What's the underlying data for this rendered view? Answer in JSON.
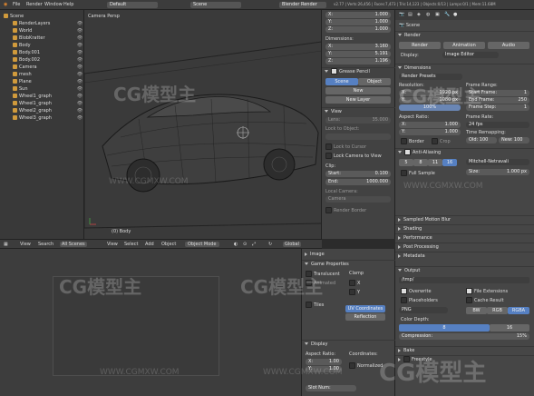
{
  "topbar": {
    "menu": [
      "File",
      "Render",
      "Window",
      "Help"
    ],
    "layout": "Default",
    "scene": "Scene",
    "engine": "Blender Render",
    "stats": "v2.77 | Verts:26,456 | Faces:7,473 | Tris:14,123 | Objects:0/13 | Lamps:0/1 | Mem:11.68M"
  },
  "outliner": {
    "items": [
      {
        "label": "Scene",
        "depth": 0
      },
      {
        "label": "RenderLayers",
        "depth": 1
      },
      {
        "label": "World",
        "depth": 1
      },
      {
        "label": "BlobKratter",
        "depth": 1
      },
      {
        "label": "Body",
        "depth": 1
      },
      {
        "label": "Body.001",
        "depth": 1
      },
      {
        "label": "Body.002",
        "depth": 1
      },
      {
        "label": "Camera",
        "depth": 1
      },
      {
        "label": "mesh",
        "depth": 1
      },
      {
        "label": "Plane",
        "depth": 1
      },
      {
        "label": "Sun",
        "depth": 1
      },
      {
        "label": "Wheel1_graph",
        "depth": 1
      },
      {
        "label": "Wheel1_graph",
        "depth": 1
      },
      {
        "label": "Wheel2_graph",
        "depth": 1
      },
      {
        "label": "Wheel3_graph",
        "depth": 1
      }
    ]
  },
  "viewport": {
    "title": "Camera Persp",
    "object_label": "(0) Body"
  },
  "npanel": {
    "scale": [
      {
        "axis": "X:",
        "value": "1.000"
      },
      {
        "axis": "Y:",
        "value": "1.000"
      },
      {
        "axis": "Z:",
        "value": "1.000"
      }
    ],
    "dimensions_title": "Dimensions:",
    "dimensions": [
      {
        "axis": "X:",
        "value": "3.160"
      },
      {
        "axis": "Y:",
        "value": "5.191"
      },
      {
        "axis": "Z:",
        "value": "1.196"
      }
    ],
    "grease_pencil": "Grease Pencil",
    "gp_tabs": [
      "Scene",
      "Object"
    ],
    "gp_new": "New",
    "gp_new_layer": "New Layer",
    "view_title": "View",
    "lens": "Lens:",
    "lens_value": "35.000",
    "lock_to_object": "Lock to Object:",
    "lock_to_cursor": "Lock to Cursor",
    "lock_camera": "Lock Camera to View",
    "clip_title": "Clip:",
    "clip_start": "Start:",
    "clip_start_value": "0.100",
    "clip_end": "End:",
    "clip_end_value": "1000.000",
    "local_camera": "Local Camera:",
    "camera_value": "Camera",
    "render_border": "Render Border"
  },
  "view_header": {
    "menu": [
      "View",
      "Search",
      "All Scenes",
      "View",
      "Select",
      "Add",
      "Object"
    ],
    "mode": "Object Mode",
    "orientation": "Global"
  },
  "uv_panel": {
    "image_title": "Image",
    "game_props": "Game Properties",
    "translucent": "Translucent",
    "clamp_title": "Clamp",
    "clamp_x": "X",
    "clamp_y": "Y",
    "animated": "Animated",
    "tiles": "Tiles",
    "uv_coordinates": "UV Coordinates",
    "reflection": "Reflection",
    "display_title": "Display",
    "aspect_ratio": "Aspect Ratio:",
    "coordinates": "Coordinates:",
    "ax": "X:",
    "ax_value": "1.00",
    "ay": "Y:",
    "ay_value": "1.00",
    "normalized": "Normalized",
    "slot_num": "Slot Num:"
  },
  "props": {
    "scene": "Scene",
    "render_title": "Render",
    "render_btns": [
      "Render",
      "Animation",
      "Audio"
    ],
    "display_label": "Display:",
    "display_value": "Image Editor",
    "dimensions_title": "Dimensions",
    "render_presets": "Render Presets",
    "resolution_label": "Resolution:",
    "res_x": "X:",
    "res_x_value": "1920 px",
    "res_y": "Y:",
    "res_y_value": "1080 px",
    "res_pct": "100%",
    "frame_range": "Frame Range:",
    "start_frame": "Start Frame:",
    "start_frame_value": "1",
    "end_frame": "End Frame:",
    "end_frame_value": "250",
    "frame_step": "Frame Step:",
    "frame_step_value": "1",
    "aspect_label": "Aspect Ratio:",
    "asp_x": "X:",
    "asp_x_value": "1.000",
    "asp_y": "Y:",
    "asp_y_value": "1.000",
    "frame_rate": "Frame Rate:",
    "fps": "24 fps",
    "time_remap": "Time Remapping:",
    "old": "Old: 100",
    "new": "New: 100",
    "border": "Border",
    "crop": "Crop",
    "aa_title": "Anti-Aliasing",
    "aa_levels": [
      "5",
      "8",
      "11",
      "16"
    ],
    "aa_filter": "Mitchell-Netravali",
    "full_sample": "Full Sample",
    "size_label": "Size:",
    "size_value": "1.000 px",
    "sections": [
      "Sampled Motion Blur",
      "Shading",
      "Performance",
      "Post Processing",
      "Metadata"
    ],
    "output_title": "Output",
    "output_path": "/tmp/",
    "overwrite": "Overwrite",
    "file_extensions": "File Extensions",
    "placeholders": "Placeholders",
    "cache_result": "Cache Result",
    "format": "PNG",
    "color_modes": [
      "BW",
      "RGB",
      "RGBA"
    ],
    "color_depth": "Color Depth:",
    "depth_8": "8",
    "depth_16": "16",
    "compression": "Compression:",
    "compression_value": "15%",
    "bake": "Bake",
    "freestyle": "Freestyle"
  },
  "watermark": {
    "brand": "CG模型主",
    "url": "WWW.CGMXW.COM"
  }
}
